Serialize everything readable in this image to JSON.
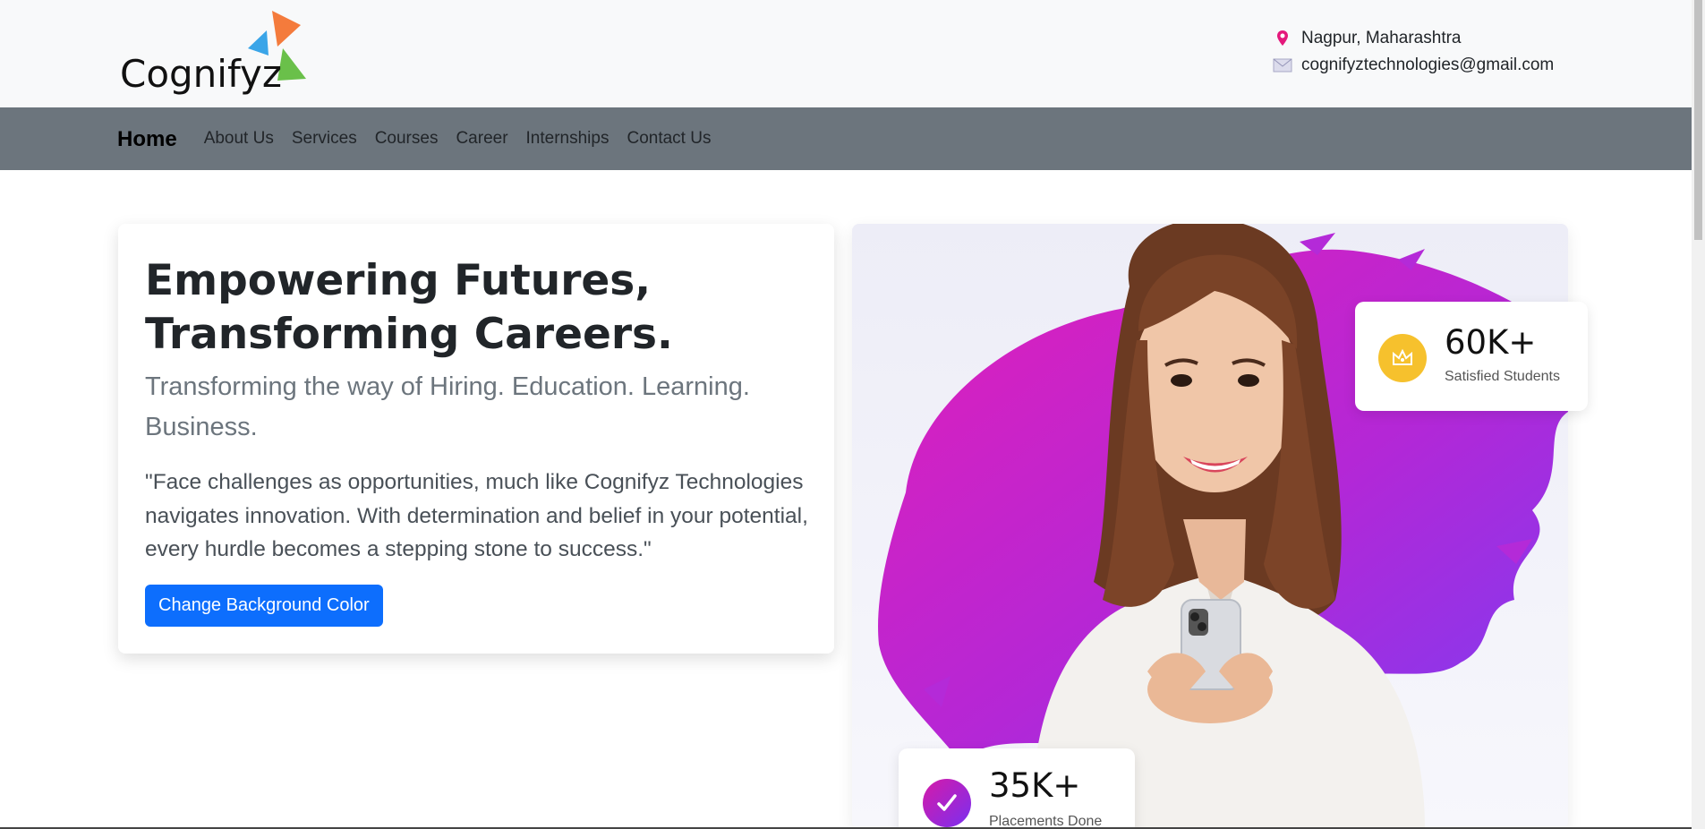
{
  "header": {
    "logo_text": "Cognifyz",
    "location": "Nagpur, Maharashtra",
    "email": "cognifyztechnologies@gmail.com",
    "location_icon": "map-pin-icon",
    "email_icon": "envelope-icon"
  },
  "nav": {
    "brand": "Home",
    "links": [
      "About Us",
      "Services",
      "Courses",
      "Career",
      "Internships",
      "Contact Us"
    ]
  },
  "hero": {
    "title_line1": "Empowering Futures,",
    "title_line2": "Transforming Careers.",
    "subtitle": "Transforming the way of Hiring. Education. Learning. Business.",
    "quote": "\"Face challenges as opportunities, much like Cognifyz Technologies navigates innovation. With determination and belief in your potential, every hurdle becomes a stepping stone to success.\"",
    "button_label": "Change Background Color"
  },
  "stats": [
    {
      "number": "60K+",
      "label": "Satisfied Students",
      "icon": "crown-icon",
      "color": "#f6c12d"
    },
    {
      "number": "35K+",
      "label": "Placements Done",
      "icon": "check-icon",
      "color": "#b024c8"
    }
  ],
  "colors": {
    "nav_bg": "#6c757d",
    "topbar_bg": "#f8f9fa",
    "primary_button": "#0d6efd",
    "brush_start": "#e21fb8",
    "brush_end": "#8a3cf0"
  }
}
